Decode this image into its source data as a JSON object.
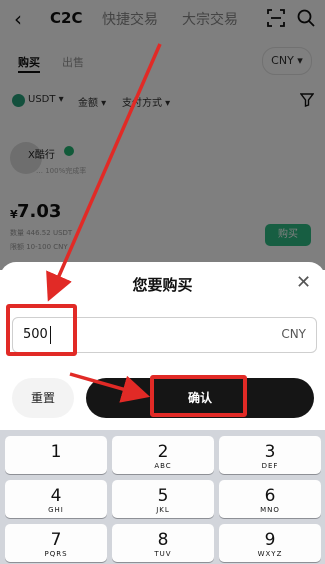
{
  "topbar": {
    "back_icon": "back-chevron-icon",
    "tabs": [
      {
        "label": "C2C",
        "active": true
      },
      {
        "label": "快捷交易",
        "active": false
      },
      {
        "label": "大宗交易",
        "active": false
      }
    ],
    "scan_icon": "scan-icon",
    "search_icon": "search-icon"
  },
  "subtabs": {
    "buy": "购买",
    "sell": "出售",
    "currency": "CNY"
  },
  "filters": {
    "coin": "USDT",
    "amount": "金额",
    "payment": "支付方式",
    "filter_icon": "funnel-icon"
  },
  "ad": {
    "merchant_name": "X酷行",
    "merchant_meta": "… 100%完成率",
    "price_currency": "¥",
    "price": "7.03",
    "quantity_line": "数量 446.52 USDT",
    "limit_line": "限额 10-100 CNY",
    "buy_label": "购买"
  },
  "sheet": {
    "title": "您要购买",
    "close_icon": "close-icon",
    "amount_value": "500",
    "amount_unit": "CNY",
    "reset_label": "重置",
    "confirm_label": "确认"
  },
  "keypad": {
    "keys": [
      {
        "num": "1",
        "letters": ""
      },
      {
        "num": "2",
        "letters": "ABC"
      },
      {
        "num": "3",
        "letters": "DEF"
      },
      {
        "num": "4",
        "letters": "GHI"
      },
      {
        "num": "5",
        "letters": "JKL"
      },
      {
        "num": "6",
        "letters": "MNO"
      },
      {
        "num": "7",
        "letters": "PQRS"
      },
      {
        "num": "8",
        "letters": "TUV"
      },
      {
        "num": "9",
        "letters": "WXYZ"
      }
    ]
  },
  "colors": {
    "accent_green": "#2ebd85",
    "annotation_red": "#e12a26",
    "confirm_bg": "#151515"
  }
}
